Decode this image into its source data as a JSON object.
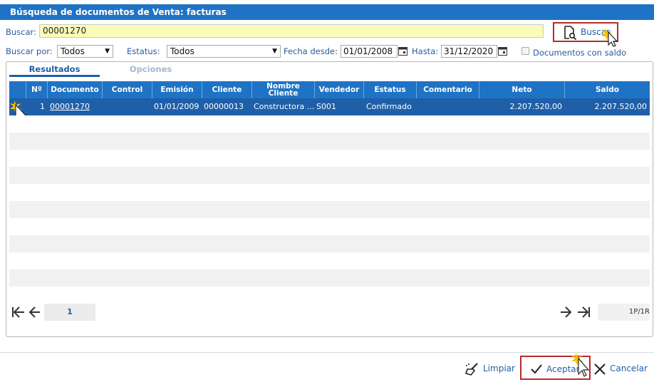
{
  "window": {
    "title": "Búsqueda de documentos de Venta: facturas"
  },
  "search": {
    "label": "Buscar:",
    "value": "00001270",
    "button_label": "Buscar"
  },
  "filters": {
    "buscar_por_label": "Buscar por:",
    "buscar_por_value": "Todos",
    "estatus_label": "Estatus:",
    "estatus_value": "Todos",
    "fecha_desde_label": "Fecha desde:",
    "fecha_desde_value": "01/01/2008",
    "hasta_label": "Hasta:",
    "hasta_value": "31/12/2020",
    "con_saldo_label": "Documentos con saldo"
  },
  "tabs": [
    {
      "label": "Resultados",
      "active": true
    },
    {
      "label": "Opciones",
      "active": false
    }
  ],
  "grid": {
    "columns": [
      "Nº",
      "Documento",
      "Control",
      "Emisión",
      "Cliente",
      "Nombre Cliente",
      "Vendedor",
      "Estatus",
      "Comentario",
      "Neto",
      "Saldo"
    ],
    "rows": [
      {
        "n": "1",
        "documento": "00001270",
        "control": "",
        "emision": "01/01/2009",
        "cliente": "00000013",
        "nombre_cliente": "Constructora ...",
        "vendedor": "S001",
        "estatus": "Confirmado",
        "comentario": "",
        "neto": "2.207.520,00",
        "saldo": "2.207.520,00"
      }
    ]
  },
  "pager": {
    "page": "1",
    "summary": "1P/1R"
  },
  "footer": {
    "limpiar_label": "Limpiar",
    "aceptar_label": "Aceptar",
    "cancelar_label": "Cancelar"
  },
  "colors": {
    "accent": "#1f73c5",
    "selected_row": "#1f5fa8",
    "highlight_border": "#b62c2c",
    "search_bg": "#fdfbb8"
  }
}
